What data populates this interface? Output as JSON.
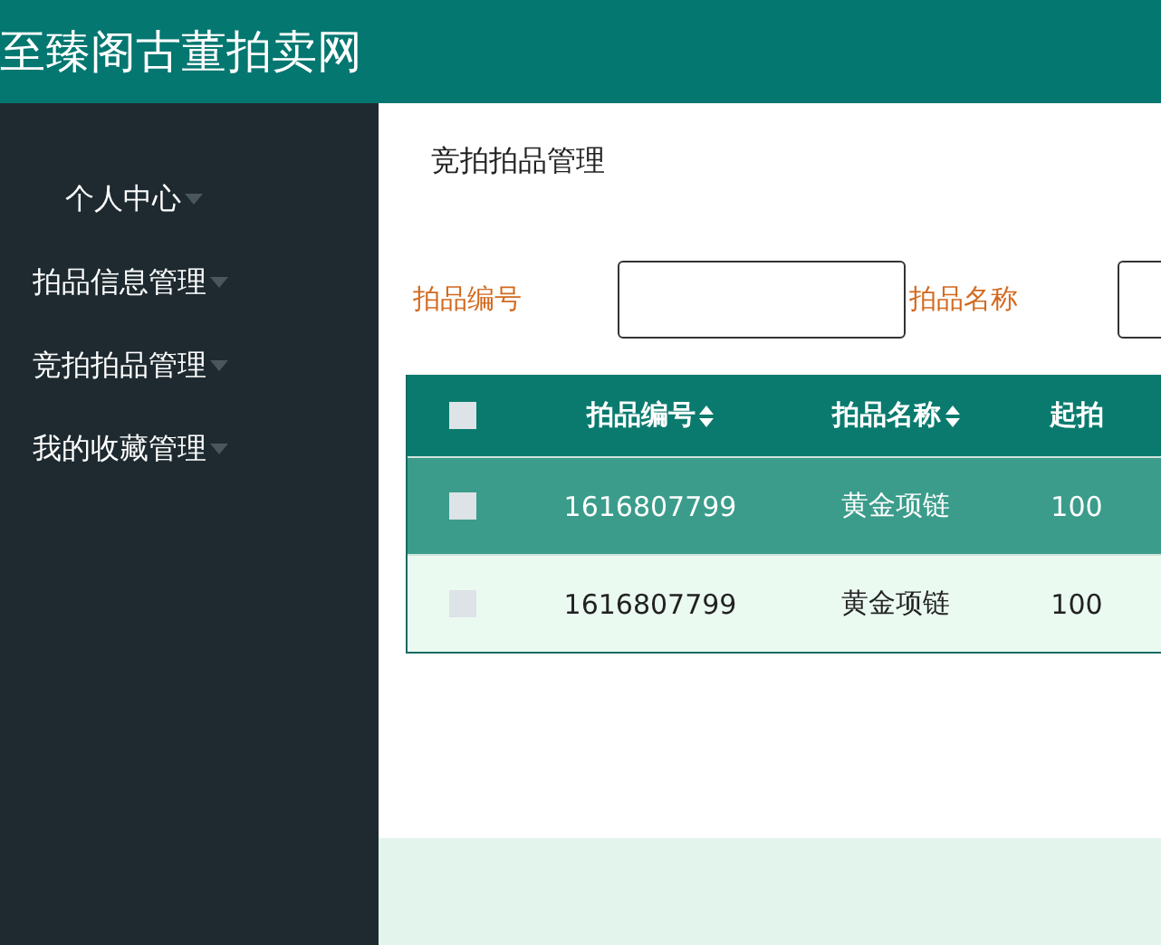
{
  "header": {
    "title": "至臻阁古董拍卖网"
  },
  "sidebar": {
    "items": [
      {
        "label": "个人中心",
        "kind": "home"
      },
      {
        "label": "拍品信息管理",
        "kind": "menu"
      },
      {
        "label": "竞拍拍品管理",
        "kind": "menu"
      },
      {
        "label": "我的收藏管理",
        "kind": "menu"
      }
    ]
  },
  "page_title": "竞拍拍品管理",
  "search": {
    "fields": [
      {
        "label": "拍品编号"
      },
      {
        "label": "拍品名称"
      }
    ]
  },
  "table": {
    "all_checked": false,
    "columns": [
      {
        "label": "拍品编号",
        "sortable": true
      },
      {
        "label": "拍品名称",
        "sortable": true
      },
      {
        "label": "起拍",
        "sortable": false
      }
    ],
    "rows": [
      {
        "selected": true,
        "checked": false,
        "cells": [
          "1616807799",
          "黄金项链",
          "100"
        ]
      },
      {
        "selected": false,
        "checked": false,
        "cells": [
          "1616807799",
          "黄金项链",
          "100"
        ]
      }
    ]
  }
}
